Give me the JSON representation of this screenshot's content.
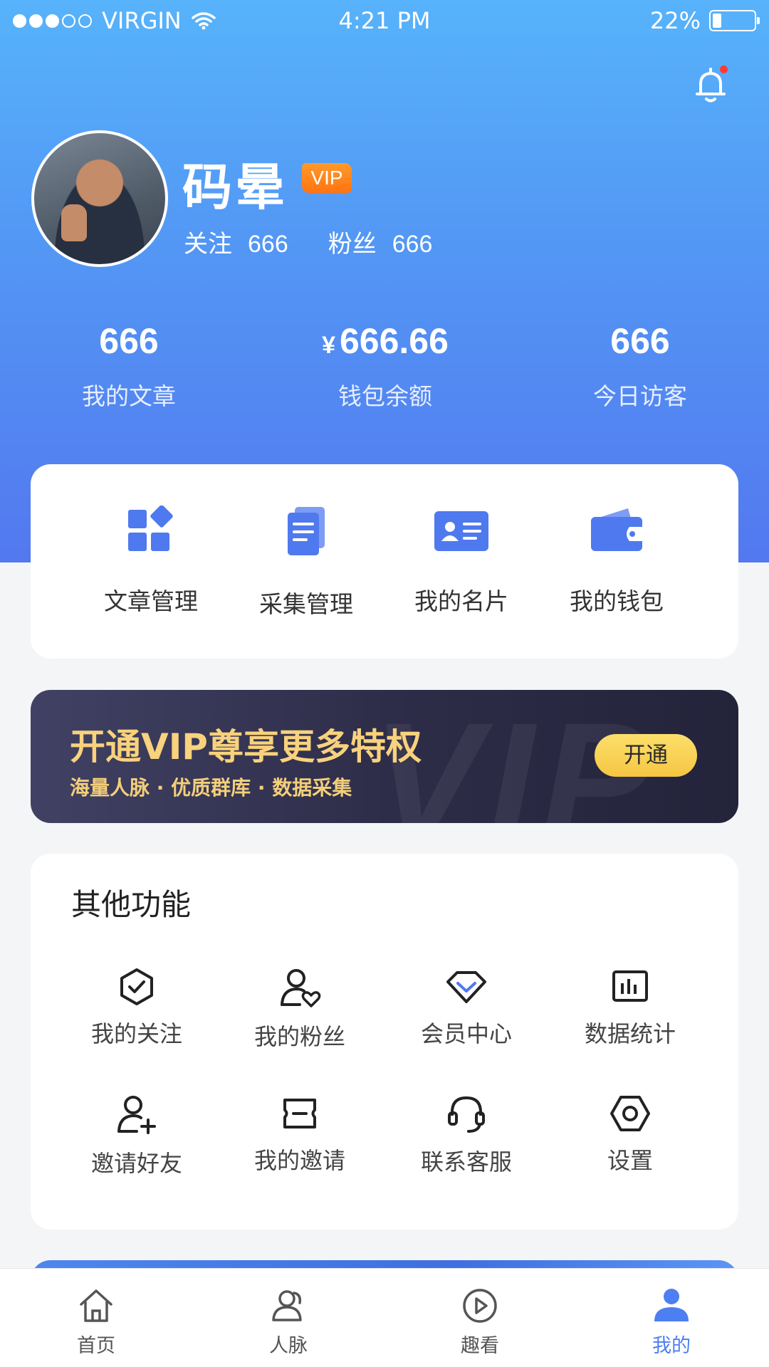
{
  "status_bar": {
    "carrier": "VIRGIN",
    "time": "4:21 PM",
    "battery": "22%",
    "battery_level": 0.22
  },
  "profile": {
    "name": "码晕",
    "vip_badge": "VIP",
    "follow_label": "关注",
    "follow_count": "666",
    "fans_label": "粉丝",
    "fans_count": "666"
  },
  "stats": [
    {
      "value": "666",
      "label": "我的文章"
    },
    {
      "currency": "¥",
      "value": "666.66",
      "label": "钱包余额"
    },
    {
      "value": "666",
      "label": "今日访客"
    }
  ],
  "quick_actions": [
    {
      "label": "文章管理",
      "icon": "grid-diamond-icon"
    },
    {
      "label": "采集管理",
      "icon": "documents-icon"
    },
    {
      "label": "我的名片",
      "icon": "id-card-icon"
    },
    {
      "label": "我的钱包",
      "icon": "wallet-icon"
    }
  ],
  "vip_banner": {
    "title": "开通VIP尊享更多特权",
    "subtitle": "海量人脉 · 优质群库 · 数据采集",
    "button": "开通",
    "background_text": "VIP"
  },
  "other_functions": {
    "title": "其他功能",
    "items": [
      {
        "label": "我的关注",
        "icon": "shield-check-icon"
      },
      {
        "label": "我的粉丝",
        "icon": "user-heart-icon"
      },
      {
        "label": "会员中心",
        "icon": "diamond-icon"
      },
      {
        "label": "数据统计",
        "icon": "bar-chart-icon"
      },
      {
        "label": "邀请好友",
        "icon": "user-add-icon"
      },
      {
        "label": "我的邀请",
        "icon": "ticket-icon"
      },
      {
        "label": "联系客服",
        "icon": "headset-icon"
      },
      {
        "label": "设置",
        "icon": "hexagon-settings-icon"
      }
    ]
  },
  "tab_bar": [
    {
      "label": "首页",
      "icon": "home-icon",
      "active": false
    },
    {
      "label": "人脉",
      "icon": "contacts-icon",
      "active": false
    },
    {
      "label": "趣看",
      "icon": "play-icon",
      "active": false
    },
    {
      "label": "我的",
      "icon": "profile-icon",
      "active": true
    }
  ],
  "colors": {
    "accent": "#4d7ef2",
    "vip_gold": "#f8d27c",
    "badge_orange": "#ff7410"
  }
}
